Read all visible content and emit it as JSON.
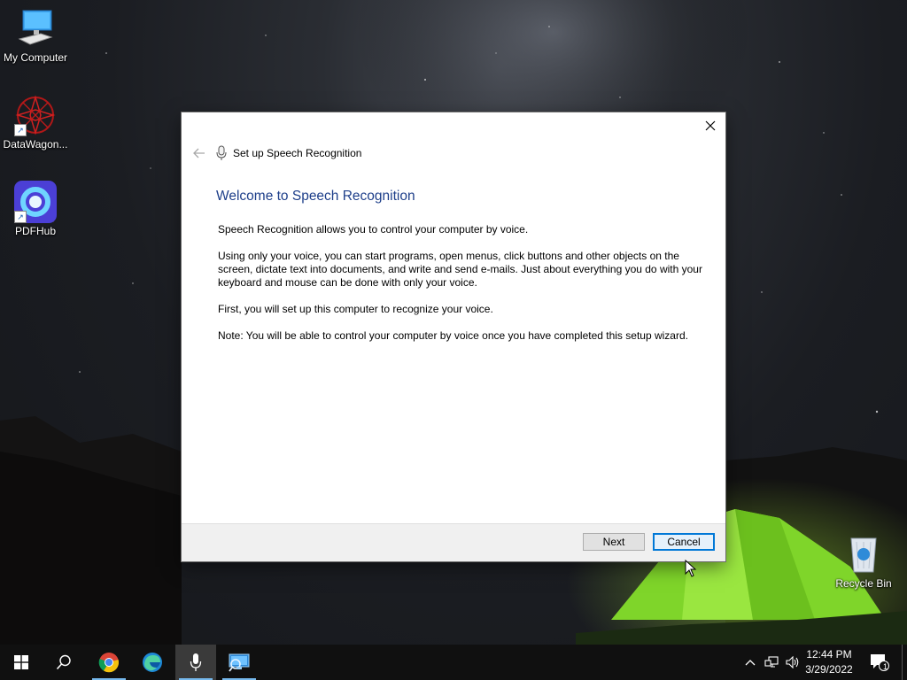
{
  "desktop": {
    "icons": [
      {
        "label": "My Computer",
        "icon": "monitor-icon"
      },
      {
        "label": "DataWagon...",
        "icon": "datawagon-logo-icon"
      },
      {
        "label": "PDFHub",
        "icon": "pdfhub-logo-icon"
      },
      {
        "label": "Recycle Bin",
        "icon": "recycle-bin-icon"
      }
    ]
  },
  "dialog": {
    "title": "Set up Speech Recognition",
    "heading": "Welcome to Speech Recognition",
    "paragraphs": [
      "Speech Recognition allows you to control your computer by voice.",
      "Using only your voice, you can start programs, open menus, click buttons and other objects on the screen, dictate text into documents, and write and send e-mails. Just about everything you do with your keyboard and mouse can be done with only your voice.",
      "First, you will set up this computer to recognize your voice.",
      "Note: You will be able to control your computer by voice once you have completed this setup wizard."
    ],
    "buttons": {
      "next": "Next",
      "cancel": "Cancel"
    },
    "icons": {
      "close": "close-icon",
      "back": "back-arrow-icon",
      "app": "microphone-icon"
    }
  },
  "taskbar": {
    "apps": [
      "start-icon",
      "search-icon",
      "chrome-icon",
      "edge-icon",
      "microphone-icon",
      "remote-desktop-icon"
    ],
    "clock": {
      "time": "12:44 PM",
      "date": "3/29/2022"
    },
    "notification_count": "1",
    "accent": "#76b9ed"
  },
  "colors": {
    "heading": "#1e3f8a",
    "taskbar": "#101010",
    "tent": "#7fd52a"
  }
}
